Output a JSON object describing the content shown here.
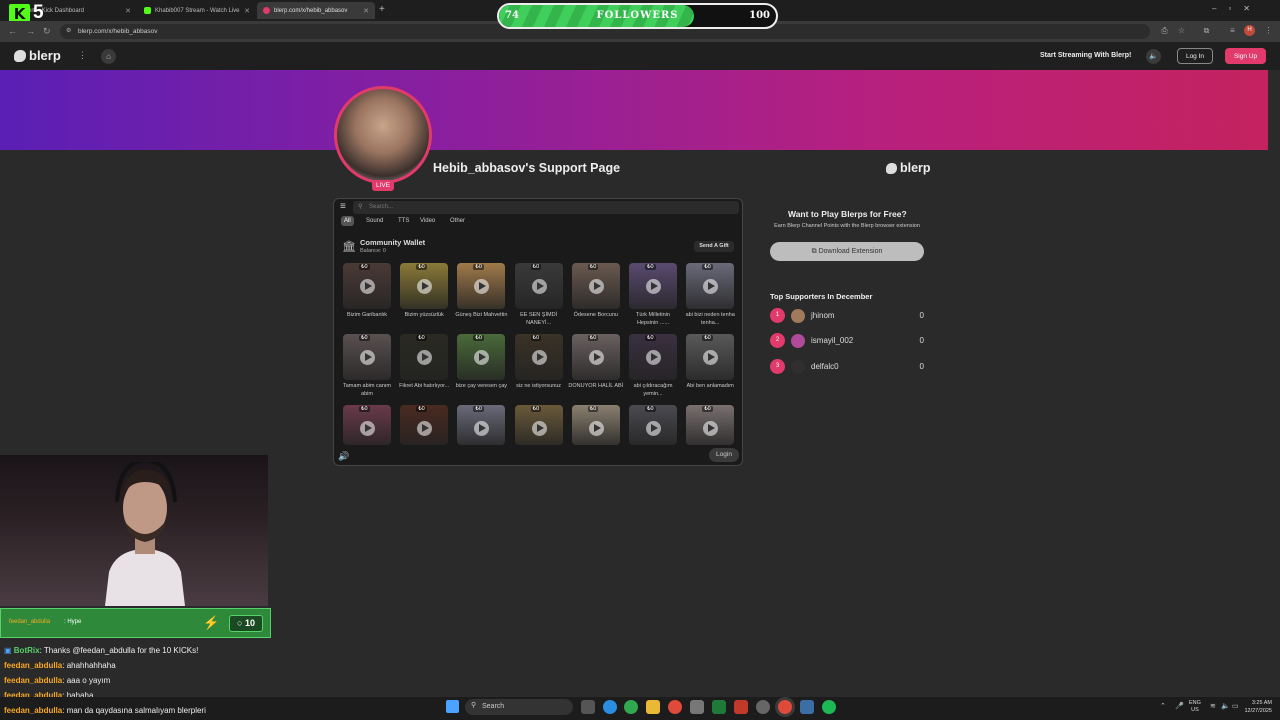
{
  "browser": {
    "tabs": [
      {
        "label": "om - Kick Dashboard"
      },
      {
        "label": "Khabib007 Stream - Watch Live"
      },
      {
        "label": "blerp.com/x/hebib_abbasov"
      }
    ],
    "url": "blerp.com/x/hebib_abbasov"
  },
  "overlay": {
    "kick_number": "5",
    "followers_label": "FOLLOWERS",
    "followers_current": "74",
    "followers_goal": "100",
    "followers_progress": 0.74
  },
  "site": {
    "logo": "blerp",
    "start_streaming": "Start Streaming With Blerp!",
    "login": "Log In",
    "signup": "Sign Up"
  },
  "profile": {
    "live": "LIVE",
    "title": "Hebib_abbasov's Support Page"
  },
  "widget": {
    "search_placeholder": "Search...",
    "filters": [
      "All",
      "Sound",
      "TTS",
      "Video",
      "Other"
    ],
    "wallet_title": "Community Wallet",
    "wallet_balance": "Balance: 0",
    "send_gift": "Send A Gift",
    "tiles": [
      {
        "cost": "₺0",
        "label": "Bizim Garibanlık"
      },
      {
        "cost": "₺0",
        "label": "Bizim yüzsüzlük"
      },
      {
        "cost": "₺0",
        "label": "Güneş Bizi Mahvettin"
      },
      {
        "cost": "₺0",
        "label": "EE SEN ŞİMDİ NANEYİ..."
      },
      {
        "cost": "₺0",
        "label": "Ödesene Borcunu"
      },
      {
        "cost": "₺0",
        "label": "Türk Milletinin Hepsinin ......"
      },
      {
        "cost": "₺0",
        "label": "abi bizi neden tenha tenha..."
      },
      {
        "cost": "₺0",
        "label": "Tamam abim canım abim"
      },
      {
        "cost": "₺0",
        "label": "Fikret Abi hatırlıyor..."
      },
      {
        "cost": "₺0",
        "label": "bize çay veresen çay"
      },
      {
        "cost": "₺0",
        "label": "siz ne istiyorsunuz"
      },
      {
        "cost": "₺0",
        "label": "DONUYOR HALİL ABİ"
      },
      {
        "cost": "₺0",
        "label": "abi çıldıracağım yemin..."
      },
      {
        "cost": "₺0",
        "label": "Abi ben anlamadım"
      },
      {
        "cost": "₺0",
        "label": ""
      },
      {
        "cost": "₺0",
        "label": ""
      },
      {
        "cost": "₺0",
        "label": ""
      },
      {
        "cost": "₺0",
        "label": ""
      },
      {
        "cost": "₺0",
        "label": ""
      },
      {
        "cost": "₺0",
        "label": ""
      },
      {
        "cost": "₺0",
        "label": ""
      }
    ],
    "login": "Login"
  },
  "sidebar": {
    "logo": "blerp",
    "promo_title": "Want to Play Blerps for Free?",
    "promo_text": "Earn Blerp Channel Points with the Blerp browser extension",
    "download": "Download Extension",
    "supporters_title": "Top Supporters In December",
    "supporters": [
      {
        "rank": "1",
        "name": "jhinom",
        "score": "0"
      },
      {
        "rank": "2",
        "name": "ismayil_002",
        "score": "0"
      },
      {
        "rank": "3",
        "name": "delfalc0",
        "score": "0"
      }
    ]
  },
  "chat": {
    "hype_user": "feedan_abdulla",
    "hype_text": ": Hype",
    "hype_count": "10",
    "messages": [
      {
        "user": "BotRix",
        "text": ": Thanks @feedan_abdulla for the 10 KICKs!"
      },
      {
        "user": "feedan_abdulla",
        "text": ": ahahhahhaha"
      },
      {
        "user": "feedan_abdulla",
        "text": ": aaa o yayım"
      },
      {
        "user": "feedan_abdulla",
        "text": ": hahaha"
      },
      {
        "user": "feedan_abdulla",
        "text": ": man da qaydasına salmalıyam blerpleri"
      }
    ]
  },
  "taskbar": {
    "search": "Search",
    "lang_top": "ENG",
    "lang_bottom": "US",
    "time": "3:25 AM",
    "date": "12/27/2025"
  },
  "colors": {
    "accent": "#e23a6a",
    "kick_green": "#53fc18",
    "banner_start": "#5a1fb5",
    "banner_end": "#c4225f"
  }
}
